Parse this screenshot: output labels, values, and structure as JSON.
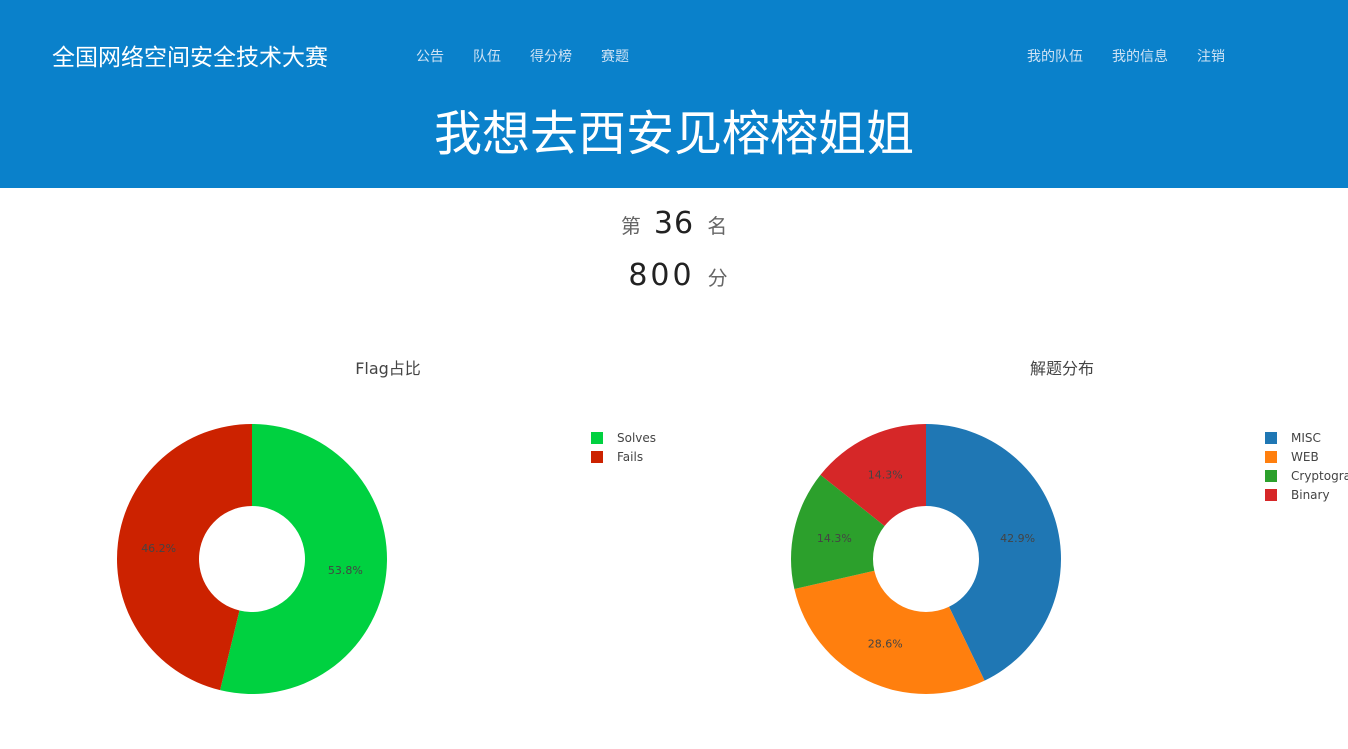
{
  "nav": {
    "brand": "全国网络空间安全技术大赛",
    "left_links": [
      "公告",
      "队伍",
      "得分榜",
      "赛题"
    ],
    "right_links": [
      "我的队伍",
      "我的信息",
      "注销"
    ]
  },
  "team": {
    "name": "我想去西安见榕榕姐姐",
    "rank_prefix": "第",
    "rank": "36",
    "rank_suffix": "名",
    "score": "800",
    "score_unit": "分"
  },
  "colors": {
    "header_bg": "#0a81cb",
    "solves": "#00d140",
    "fails": "#cc2200",
    "misc": "#1f77b4",
    "web": "#ff7f0e",
    "cryptography": "#2ca02c",
    "binary": "#d62728"
  },
  "chart_data": [
    {
      "type": "pie",
      "title": "Flag占比",
      "hole": true,
      "labels": [
        "Solves",
        "Fails"
      ],
      "values": [
        53.8,
        46.2
      ],
      "text_labels": [
        "53.8%",
        "46.2%"
      ],
      "colors": [
        "#00d140",
        "#cc2200"
      ],
      "legend_position": "top-right"
    },
    {
      "type": "pie",
      "title": "解题分布",
      "hole": true,
      "labels": [
        "MISC",
        "WEB",
        "Cryptography",
        "Binary"
      ],
      "values": [
        42.9,
        28.6,
        14.3,
        14.3
      ],
      "text_labels": [
        "42.9%",
        "28.6%",
        "14.3%",
        "14.3%"
      ],
      "colors": [
        "#1f77b4",
        "#ff7f0e",
        "#2ca02c",
        "#d62728"
      ],
      "legend_position": "top-right"
    }
  ]
}
